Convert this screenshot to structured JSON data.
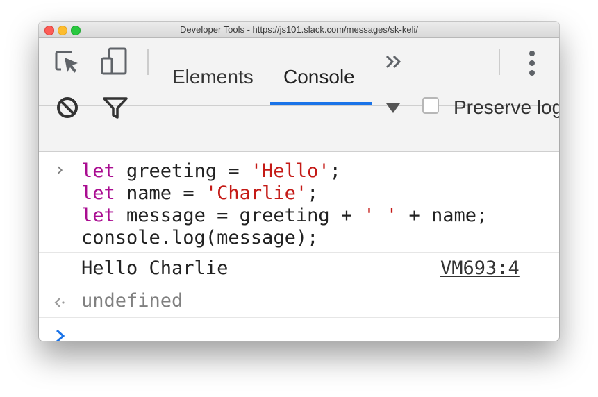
{
  "window": {
    "title": "Developer Tools - https://js101.slack.com/messages/sk-keli/"
  },
  "tabs": {
    "items": [
      {
        "label": "Elements"
      },
      {
        "label": "Console"
      }
    ],
    "active": "Console",
    "more_icon": "chevron-double-right-icon"
  },
  "toolbar": {
    "clear_icon": "block-icon",
    "filter_icon": "funnel-icon",
    "dropdown_icon": "triangle-down-icon",
    "preserve_log_label": "Preserve log",
    "preserve_log_checked": false
  },
  "console": {
    "input_lines": [
      {
        "keyword": "let",
        "rest_before": " greeting = ",
        "string": "'Hello'",
        "rest_after": ";"
      },
      {
        "keyword": "let",
        "rest_before": " name = ",
        "string": "'Charlie'",
        "rest_after": ";"
      },
      {
        "keyword": "let",
        "rest_before": " message = greeting + ",
        "string": "' '",
        "rest_after": " + name;"
      },
      {
        "plain": "console.log(message);"
      }
    ],
    "log_output": "Hello Charlie",
    "log_source": "VM693:4",
    "return_value": "undefined"
  },
  "colors": {
    "keyword": "#aa0d91",
    "string": "#c41a16",
    "accent": "#1a73e8"
  }
}
